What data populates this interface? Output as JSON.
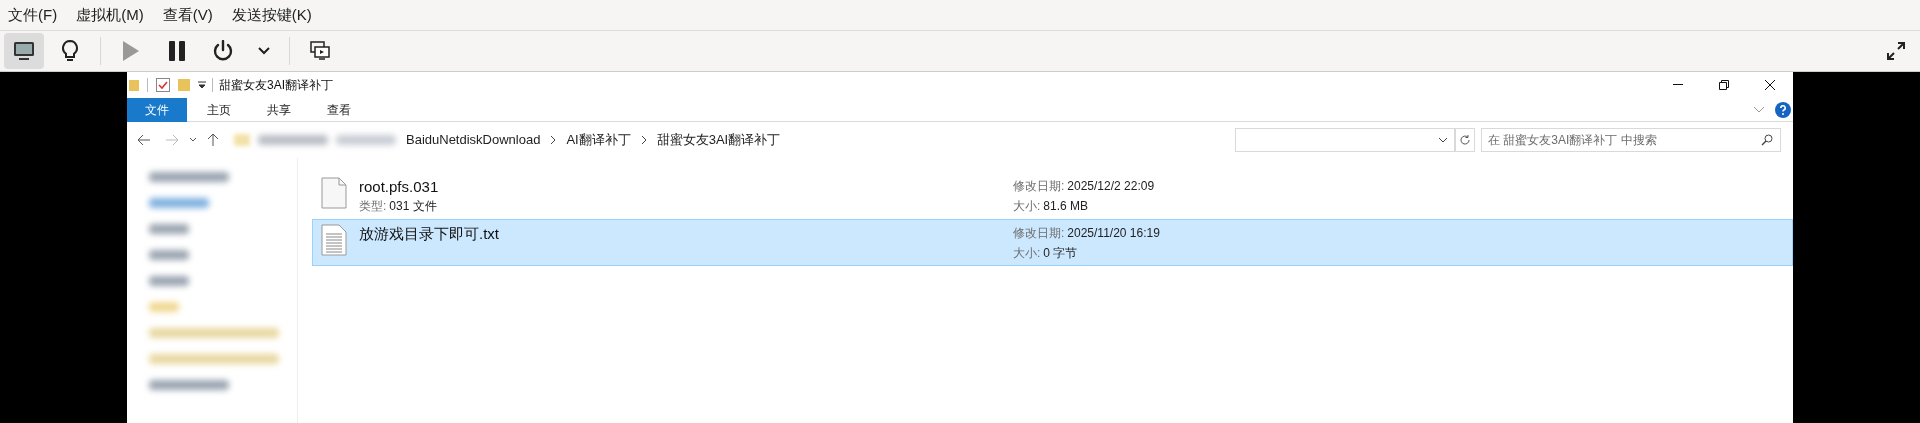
{
  "menu_bar": [
    {
      "label": "文件(F)"
    },
    {
      "label": "虚拟机(M)"
    },
    {
      "label": "查看(V)"
    },
    {
      "label": "发送按键(K)"
    }
  ],
  "toolbar": [
    {
      "kind": "display",
      "selected": true,
      "disabled": false
    },
    {
      "kind": "bulb",
      "selected": false,
      "disabled": false
    },
    {
      "kind": "separator"
    },
    {
      "kind": "play",
      "selected": false,
      "disabled": true
    },
    {
      "kind": "pause",
      "selected": false,
      "disabled": false
    },
    {
      "kind": "power",
      "selected": false,
      "disabled": false
    },
    {
      "kind": "caret",
      "selected": false,
      "disabled": false
    },
    {
      "kind": "separator"
    },
    {
      "kind": "screens",
      "selected": false,
      "disabled": false
    }
  ],
  "explorer": {
    "title": "甜蜜女友3AI翻译补丁",
    "ribbon_tabs": [
      {
        "label": "文件",
        "kind": "file_menu"
      },
      {
        "label": "主页",
        "kind": "tab"
      },
      {
        "label": "共享",
        "kind": "tab"
      },
      {
        "label": "查看",
        "kind": "tab"
      }
    ],
    "breadcrumb": [
      "BaiduNetdiskDownload",
      "AI翻译补丁",
      "甜蜜女友3AI翻译补丁"
    ],
    "search": {
      "placeholder": "在 甜蜜女友3AI翻译补丁 中搜索"
    },
    "files": [
      {
        "name": "root.pfs.031",
        "kind": "blank",
        "selected": false,
        "type_label": "类型:",
        "type": "031 文件",
        "date_label": "修改日期:",
        "date": "2025/12/2 22:09",
        "size_label": "大小:",
        "size": "81.6 MB"
      },
      {
        "name": "放游戏目录下即可.txt",
        "kind": "text",
        "selected": true,
        "date_label": "修改日期:",
        "date": "2025/11/20 16:19",
        "size_label": "大小:",
        "size": "0 字节"
      }
    ]
  }
}
